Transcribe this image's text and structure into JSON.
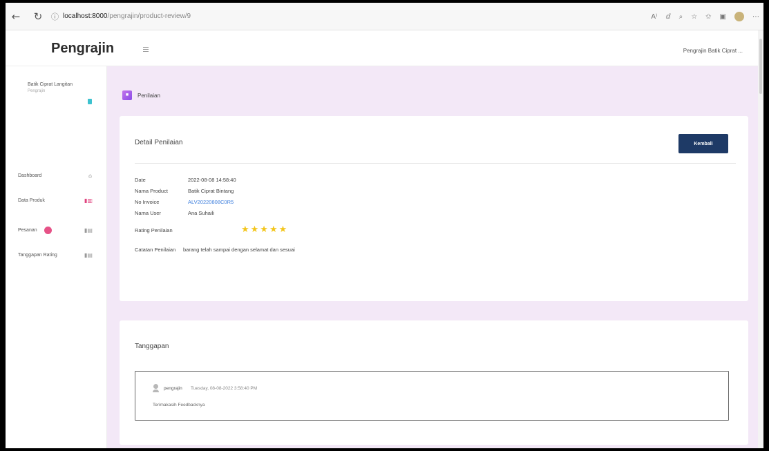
{
  "browser": {
    "back_icon": "back-arrow-icon",
    "refresh_icon": "refresh-icon",
    "info_icon": "info-icon",
    "url_host": "localhost:8000",
    "url_path": "/pengrajin/product-review/9",
    "icons": [
      "read-aloud-icon",
      "immersive-reader-icon",
      "zoom-icon",
      "collections-icon",
      "favorites-icon",
      "split-screen-icon",
      "profile-icon",
      "more-icon"
    ]
  },
  "topbar": {
    "brand": "Pengrajin",
    "user_menu": "Pengrajin Batik Ciprat ..."
  },
  "sidebar": {
    "profile_name": "Batik Ciprat Langitan",
    "profile_role": "Pengrajin",
    "items": [
      {
        "label": "Dashboard",
        "icon": "home-icon"
      },
      {
        "label": "Data Produk",
        "icon": "product-icon"
      },
      {
        "label": "Pesanan",
        "icon": "order-icon",
        "badge": true
      },
      {
        "label": "Tanggapan Rating",
        "icon": "rating-icon"
      }
    ]
  },
  "main": {
    "header_icon": "review-icon",
    "header_title": "Penilaian",
    "detail": {
      "title": "Detail Penilaian",
      "back_label": "Kembali",
      "fields": [
        {
          "label": "Date",
          "value": "2022-08-08 14:58:40"
        },
        {
          "label": "Nama Product",
          "value": "Batik Ciprat Bintang"
        },
        {
          "label": "No Invoice",
          "value": "ALV20220808C0R5"
        },
        {
          "label": "Nama User",
          "value": "Ana Suhaili"
        }
      ],
      "rating_label": "Rating Penilaian",
      "rating": 5,
      "rating_max": 5,
      "note_label": "Catatan Penilaian",
      "note_value": "barang telah sampai dengan selamat dan sesuai"
    },
    "response": {
      "title": "Tanggapan",
      "user": "pengrajin",
      "time": "Tuesday, 08-08-2022 3:58:40 PM",
      "text": "Terimakasih Feedbacknya"
    }
  }
}
